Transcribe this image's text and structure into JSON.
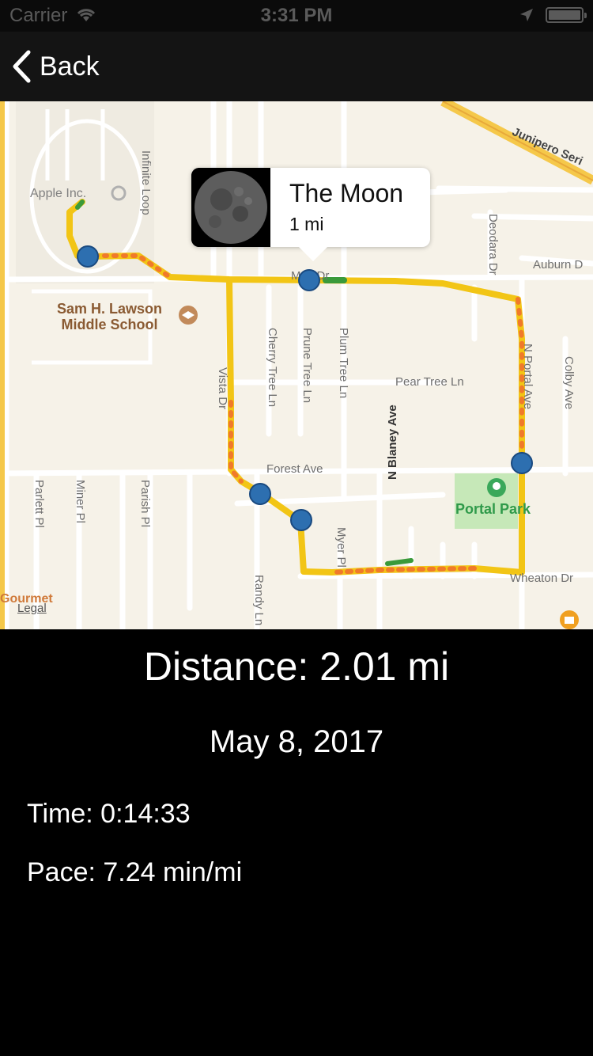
{
  "status_bar": {
    "carrier": "Carrier",
    "time": "3:31 PM"
  },
  "nav": {
    "back_label": "Back"
  },
  "map": {
    "labels": {
      "apple": "Apple Inc.",
      "school_line1": "Sam H. Lawson",
      "school_line2": "Middle School",
      "park": "Portal Park",
      "legal": "Legal",
      "gourmet": "Gourmet",
      "forest_ave": "Forest Ave",
      "pear_tree": "Pear Tree Ln",
      "wheaton": "Wheaton Dr",
      "auburn": "Auburn D",
      "junipero": "Junipero Seri",
      "moffett": "M    itt Dr",
      "infinite_loop": "Infinite Loop",
      "vista": "Vista Dr",
      "cherry": "Cherry Tree Ln",
      "prune": "Prune Tree Ln",
      "plum": "Plum Tree Ln",
      "n_blaney": "N Blaney Ave",
      "n_portal": "N Portal Ave",
      "colby": "Colby Ave",
      "deodara": "Deodara Dr",
      "myer": "Myer Pl",
      "randy": "Randy Ln",
      "parlett": "Parlett Pl",
      "miner": "Miner Pl",
      "parish": "Parish Pl"
    },
    "callout": {
      "title": "The Moon",
      "subtitle": "1 mi"
    },
    "colors": {
      "route_primary": "#f2c515",
      "route_slow": "#f07a2a",
      "route_fast": "#3a9a3a",
      "pin": "#2d6fb0"
    }
  },
  "run": {
    "distance_text": "Distance:  2.01 mi",
    "date_text": "May 8, 2017",
    "time_text": "Time:  0:14:33",
    "pace_text": "Pace:  7.24 min/mi"
  }
}
